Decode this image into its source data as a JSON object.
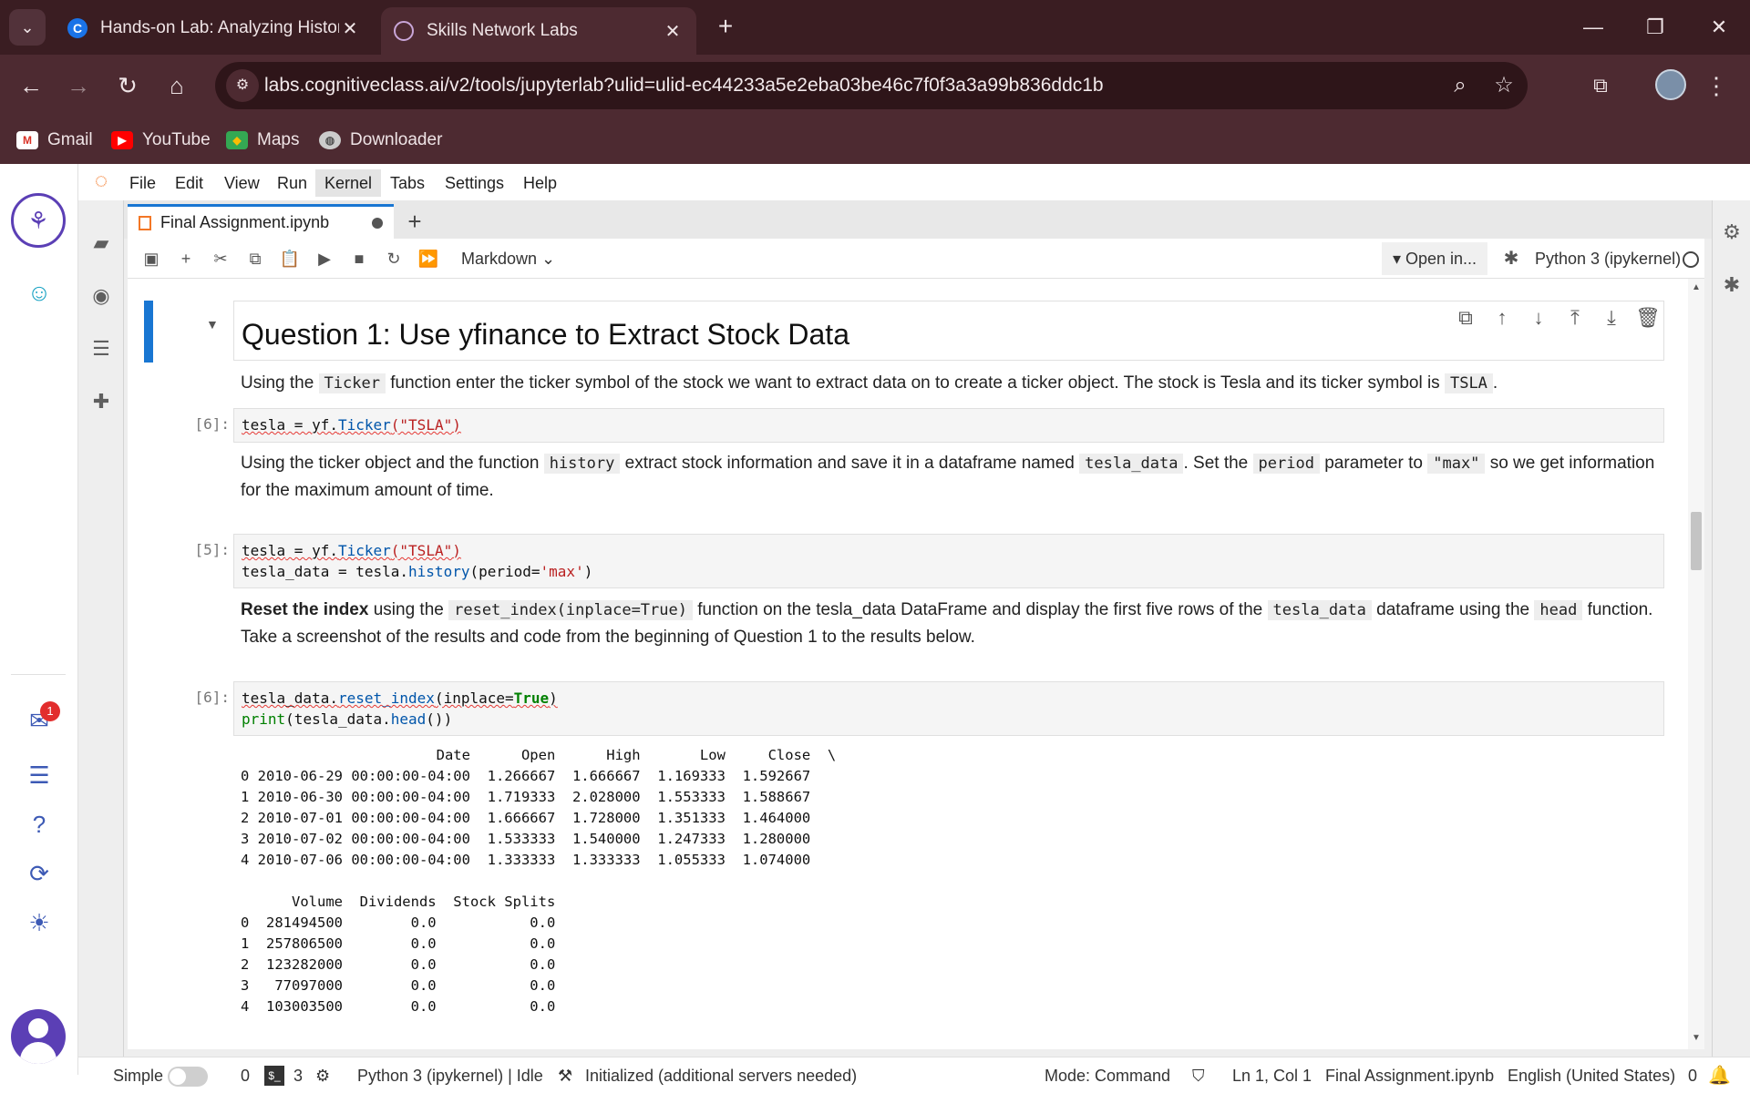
{
  "browser": {
    "tabs": [
      {
        "title": "Hands-on Lab: Analyzing Histor",
        "favicon": "c-icon"
      },
      {
        "title": "Skills Network Labs",
        "favicon": "skills-network-icon"
      }
    ],
    "url": "labs.cognitiveclass.ai/v2/tools/jupyterlab?ulid=ulid-ec44233a5e2eba03be46c7f0f3a3a99b836ddc1b",
    "bookmarks": [
      "Gmail",
      "YouTube",
      "Maps",
      "Downloader"
    ]
  },
  "menu": [
    "File",
    "Edit",
    "View",
    "Run",
    "Kernel",
    "Tabs",
    "Settings",
    "Help"
  ],
  "notebook_tab": {
    "title": "Final Assignment.ipynb"
  },
  "toolbar": {
    "cell_type": "Markdown",
    "open_in": "Open in...",
    "kernel": "Python 3 (ipykernel)"
  },
  "cells": {
    "heading": "Question 1: Use yfinance to Extract Stock Data",
    "md1": {
      "t1": "Using the ",
      "c1": "Ticker",
      "t2": " function enter the ticker symbol of the stock we want to extract data on to create a ticker object. The stock is Tesla and its ticker symbol is ",
      "c2": "TSLA",
      "t3": "."
    },
    "code1": {
      "prompt": "[6]:",
      "a": "tesla",
      "b": " = ",
      "c": "yf.",
      "d": "Ticker",
      "e": "(\"TSLA\")"
    },
    "md2": {
      "t1": "Using the ticker object and the function ",
      "c1": "history",
      "t2": " extract stock information and save it in a dataframe named ",
      "c2": "tesla_data",
      "t3": ". Set the ",
      "c3": "period",
      "t4": " parameter to ",
      "c4": "\"max\"",
      "t5": " so we get information for the maximum amount of time."
    },
    "code2": {
      "prompt": "[5]:",
      "line2a": "tesla_data = tesla.",
      "line2b": "history",
      "line2c": "(period=",
      "line2d": "'max'",
      "line2e": ")"
    },
    "md3": {
      "b1": "Reset the index",
      "t1": " using the ",
      "c1": "reset_index(inplace=True)",
      "t2": " function on the tesla_data DataFrame and display the first five rows of the ",
      "c2": "tesla_data",
      "t3": " dataframe using the ",
      "c3": "head",
      "t4": " function. Take a screenshot of the results and code from the beginning of Question 1 to the results below."
    },
    "code3": {
      "prompt": "[6]:",
      "l1a": "tesla_data.",
      "l1b": "reset_index",
      "l1c": "(inplace=",
      "l1d": "True",
      "l1e": ")",
      "l2a": "print",
      "l2b": "(tesla_data.",
      "l2c": "head",
      "l2d": "())"
    },
    "output": {
      "header1": "                       Date      Open      High       Low     Close  \\",
      "rows1": [
        "0 2010-06-29 00:00:00-04:00  1.266667  1.666667  1.169333  1.592667",
        "1 2010-06-30 00:00:00-04:00  1.719333  2.028000  1.553333  1.588667",
        "2 2010-07-01 00:00:00-04:00  1.666667  1.728000  1.351333  1.464000",
        "3 2010-07-02 00:00:00-04:00  1.533333  1.540000  1.247333  1.280000",
        "4 2010-07-06 00:00:00-04:00  1.333333  1.333333  1.055333  1.074000"
      ],
      "header2": "      Volume  Dividends  Stock Splits",
      "rows2": [
        "0  281494500        0.0           0.0",
        "1  257806500        0.0           0.0",
        "2  123282000        0.0           0.0",
        "3   77097000        0.0           0.0",
        "4  103003500        0.0           0.0"
      ]
    }
  },
  "rail": {
    "notification_count": "1"
  },
  "status": {
    "mode_label": "Simple",
    "terminals": "0",
    "kernels": "3",
    "kernel": "Python 3 (ipykernel) | Idle",
    "lsp": "Initialized (additional servers needed)",
    "mode": "Mode: Command",
    "cursor": "Ln 1, Col 1",
    "file": "Final Assignment.ipynb",
    "lang": "English (United States)",
    "notifications": "0"
  }
}
